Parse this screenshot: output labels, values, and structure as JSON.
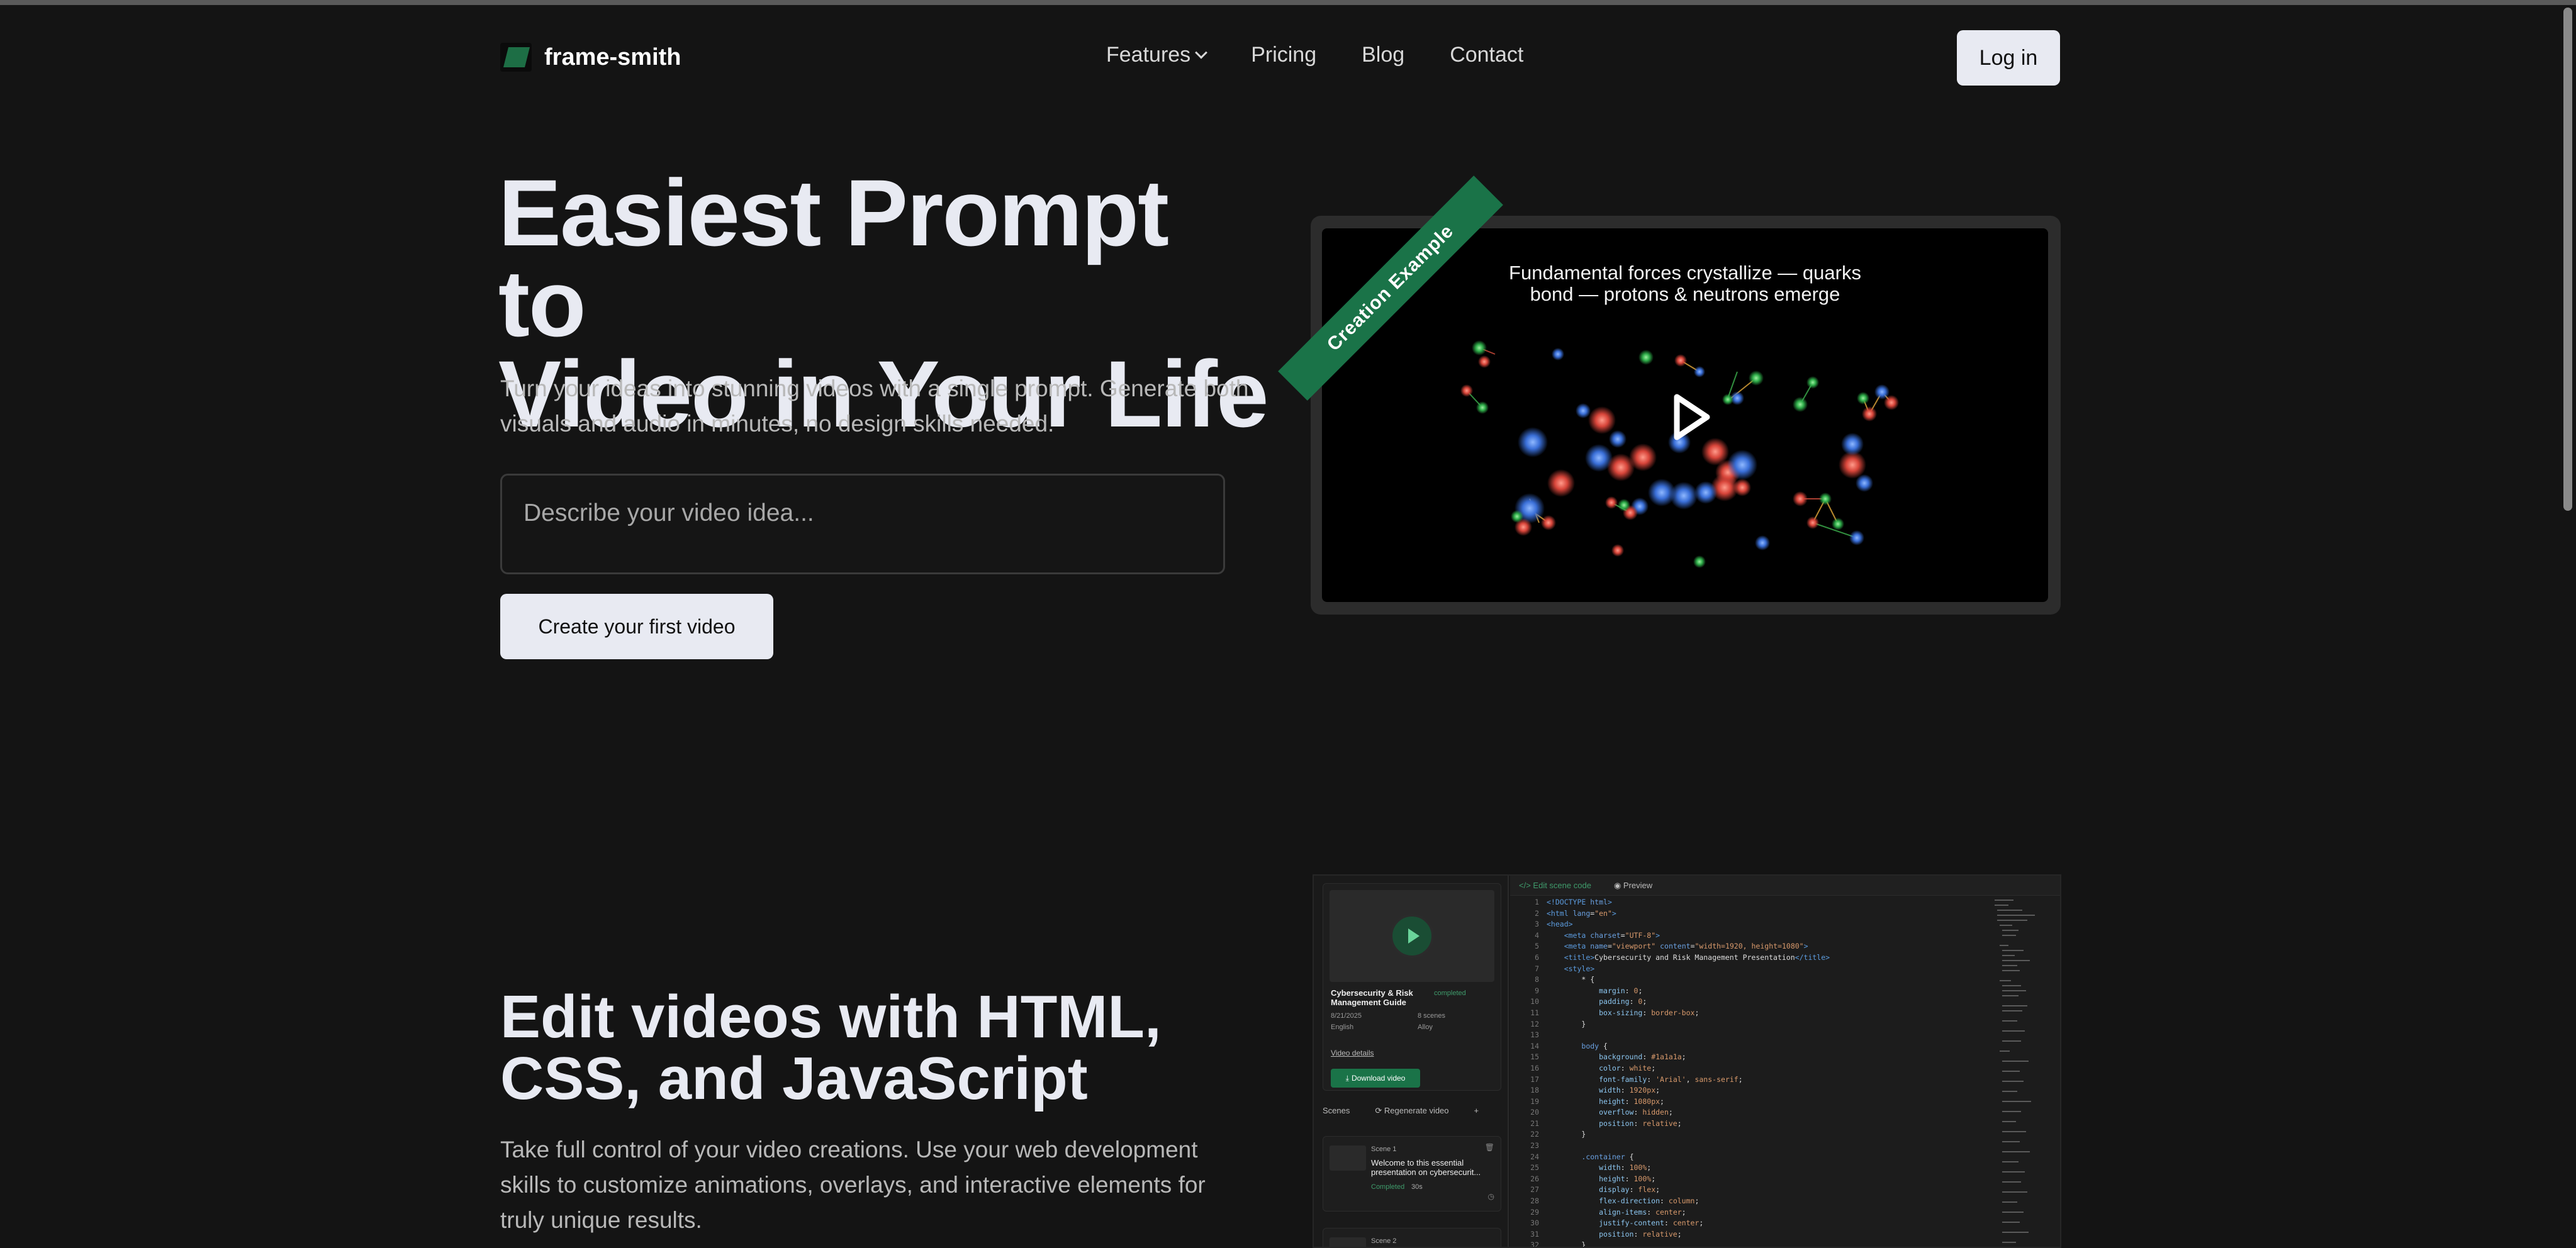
{
  "brand": {
    "name": "frame-smith"
  },
  "nav": {
    "items": [
      "Features",
      "Pricing",
      "Blog",
      "Contact"
    ],
    "login_label": "Log in"
  },
  "hero": {
    "title_line1": "Easiest Prompt to",
    "title_line2": "Video in Your Life",
    "subtitle": "Turn your ideas into stunning videos with a single prompt. Generate both visuals and audio in minutes, no design skills needed.",
    "prompt_placeholder": "Describe your video idea...",
    "cta_label": "Create your first video"
  },
  "example": {
    "ribbon": "Creation Example",
    "caption": "Fundamental forces crystallize — quarks bond — protons & neutrons emerge"
  },
  "section2": {
    "title": "Edit videos with HTML, CSS, and JavaScript",
    "subtitle": "Take full control of your video creations. Use your web development skills to customize animations, overlays, and interactive elements for truly unique results."
  },
  "editor": {
    "tabs": [
      "Edit scene code",
      "Preview"
    ],
    "video_title": "Cybersecurity & Risk Management Guide",
    "video_status": "completed",
    "date": "8/21/2025",
    "scenes_count": "8 scenes",
    "language": "English",
    "voice": "Alloy",
    "details_link": "Video details",
    "download_label": "Download video",
    "scenes_label": "Scenes",
    "regenerate_label": "Regenerate video",
    "scene1": {
      "label": "Scene 1",
      "text": "Welcome to this essential presentation on cybersecurit...",
      "status": "Completed",
      "duration": "30s"
    },
    "scene2": {
      "label": "Scene 2"
    }
  },
  "colors": {
    "accent": "#1a7348",
    "bg": "#141414",
    "text": "#e8eaf2"
  }
}
